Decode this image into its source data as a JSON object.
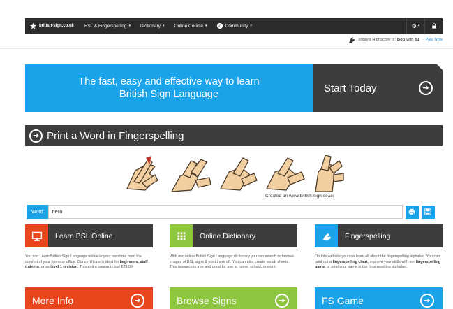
{
  "nav": {
    "brand": "british-sign.co.uk",
    "items": [
      {
        "label": "BSL & Fingerspelling",
        "caret": "▾"
      },
      {
        "label": "Dictionary",
        "caret": "▾"
      },
      {
        "label": "Online Course",
        "caret": "▾"
      },
      {
        "label": "Community",
        "caret": "▾"
      }
    ],
    "gear_caret": "▾"
  },
  "highscore": {
    "prefix": "Today's Highscore is:",
    "name": "Bob",
    "mid": "with",
    "score": "51",
    "link": "- Play Now"
  },
  "hero": {
    "line1": "The fast, easy and effective way to learn",
    "line2": "British Sign Language",
    "cta": "Start Today"
  },
  "fingerspelling": {
    "title": "Print a Word in Fingerspelling",
    "credit": "Created on www.british-sign.co.uk",
    "word_label": "Word",
    "word_value": "hello"
  },
  "columns": [
    {
      "title": "Learn BSL Online",
      "icon_color": "#e8471e",
      "text_parts": [
        "You can Learn British Sign Language online in your own time from the comfort of your home or office. Our certificate is ideal for ",
        "beginners, staff training",
        ", or as ",
        "level 1 revision",
        ". This entire course is just £39.99"
      ],
      "button": "More Info",
      "button_color": "#e8471e"
    },
    {
      "title": "Online Dictionary",
      "icon_color": "#8dc63f",
      "text_parts": [
        "With our online British Sign Language dictionary you can search or browse images of BSL signs & print them off. You can also create vocab sheets. This resource is free and great for use at home, school, or work."
      ],
      "button": "Browse Signs",
      "button_color": "#8dc63f"
    },
    {
      "title": "Fingerspelling",
      "icon_color": "#1aa3e8",
      "text_parts": [
        "On this website you can learn all about the fingerspelling alphabet. You can print out a ",
        "fingerspelling chart",
        ", improve your skills with our ",
        "fingerspelling game",
        ", or print your name in the fingerspelling alphabet."
      ],
      "button": "FS Game",
      "button_color": "#1aa3e8"
    }
  ],
  "colors": {
    "blue": "#1aa3e8",
    "dark": "#3d3d3d",
    "nav": "#2c2c2c",
    "orange": "#e8471e",
    "green": "#8dc63f"
  }
}
